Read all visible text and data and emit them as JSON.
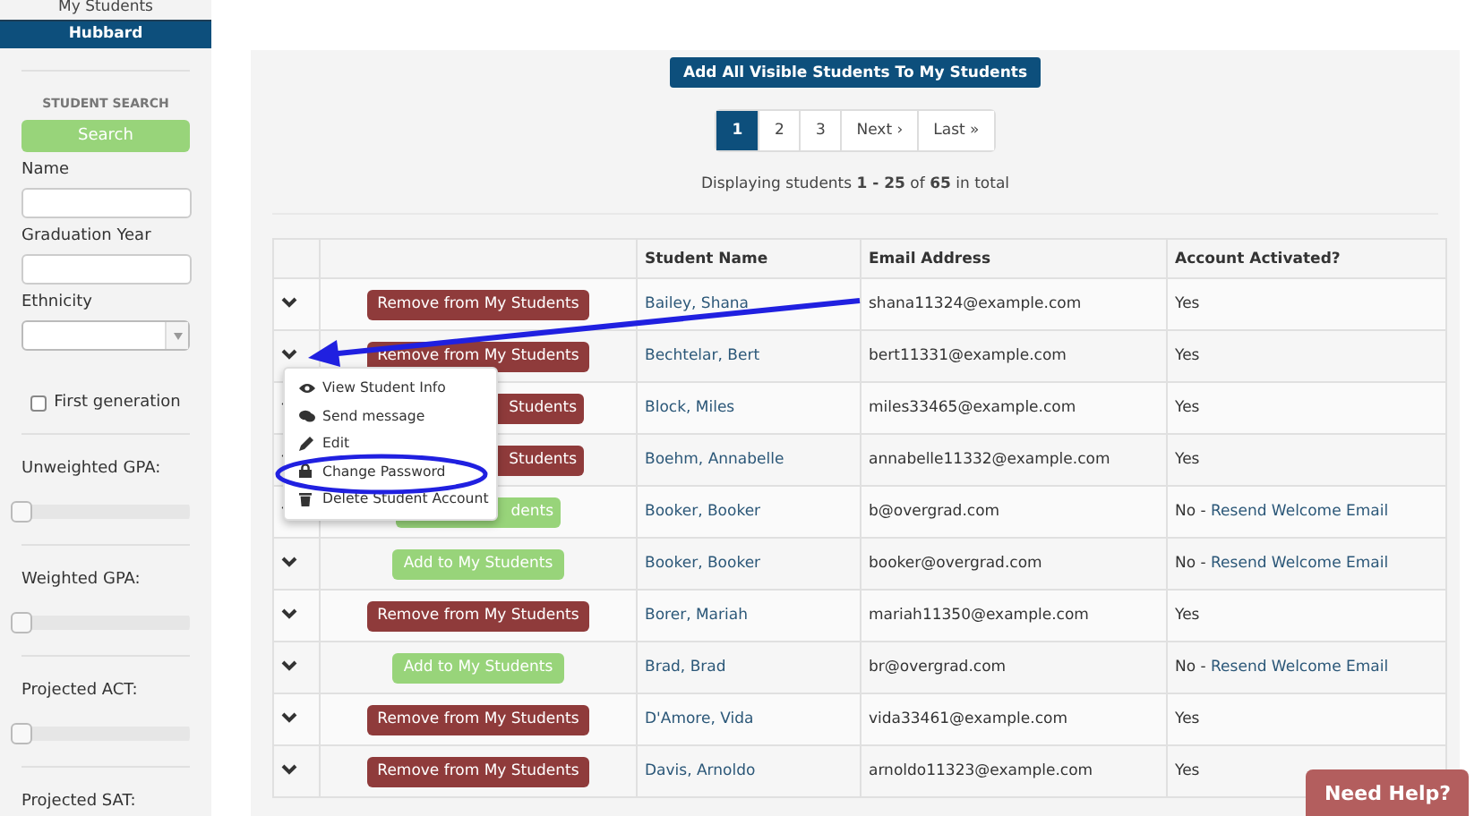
{
  "sidebar": {
    "nav": [
      {
        "label": "My Students",
        "selected": false
      },
      {
        "label": "Hubbard",
        "selected": true
      }
    ],
    "search_heading": "STUDENT SEARCH",
    "search_button": "Search",
    "filters": [
      {
        "kind": "text",
        "label": "Name"
      },
      {
        "kind": "text",
        "label": "Graduation Year"
      },
      {
        "kind": "select",
        "label": "Ethnicity"
      },
      {
        "kind": "checkbox",
        "label": "First generation",
        "checked": false
      },
      {
        "kind": "slider",
        "label": "Unweighted GPA:",
        "level": 0
      },
      {
        "kind": "slider",
        "label": "Weighted GPA:",
        "level": 0
      },
      {
        "kind": "slider",
        "label": "Projected ACT:",
        "level": 0
      },
      {
        "kind": "heading",
        "label": "Projected SAT:"
      }
    ]
  },
  "main": {
    "add_all_button": "Add All Visible Students To My Students",
    "pagination": [
      {
        "label": "1",
        "selected": true
      },
      {
        "label": "2",
        "selected": false
      },
      {
        "label": "3",
        "selected": false
      },
      {
        "label": "Next ›",
        "selected": false
      },
      {
        "label": "Last »",
        "selected": false
      }
    ],
    "summary": "Displaying students **1 - 25** of **65** in total",
    "table": {
      "columns": [
        "Student Name",
        "Email Address",
        "Account Activated?"
      ],
      "rows": [
        {
          "expanded": false,
          "action": {
            "kind": "remove",
            "label": "Remove from My Students"
          },
          "name": "Bailey, Shana",
          "email": "shana11324@example.com",
          "activated": "Yes"
        },
        {
          "expanded": true,
          "action": {
            "kind": "remove",
            "label": "Remove from My Students"
          },
          "name": "Bechtelar, Bert",
          "email": "bert11331@example.com",
          "activated": "Yes"
        },
        {
          "expanded": false,
          "action": {
            "kind": "remove",
            "label": "Students"
          },
          "name": "Block, Miles",
          "email": "miles33465@example.com",
          "activated": "Yes"
        },
        {
          "expanded": false,
          "action": {
            "kind": "remove",
            "label": "Students"
          },
          "name": "Boehm, Annabelle",
          "email": "annabelle11332@example.com",
          "activated": "Yes"
        },
        {
          "expanded": false,
          "action": {
            "kind": "add",
            "label": "dents"
          },
          "name": "Booker, Booker",
          "email": "b@overgrad.com",
          "activated": "No -",
          "resend_link": "Resend Welcome Email"
        },
        {
          "expanded": false,
          "action": {
            "kind": "add",
            "label": "Add to My Students"
          },
          "name": "Booker, Booker",
          "email": "booker@overgrad.com",
          "activated": "No -",
          "resend_link": "Resend Welcome Email"
        },
        {
          "expanded": false,
          "action": {
            "kind": "remove",
            "label": "Remove from My Students"
          },
          "name": "Borer, Mariah",
          "email": "mariah11350@example.com",
          "activated": "Yes"
        },
        {
          "expanded": false,
          "action": {
            "kind": "add",
            "label": "Add to My Students"
          },
          "name": "Brad, Brad",
          "email": "br@overgrad.com",
          "activated": "No -",
          "resend_link": "Resend Welcome Email"
        },
        {
          "expanded": false,
          "action": {
            "kind": "remove",
            "label": "Remove from My Students"
          },
          "name": "D'Amore, Vida",
          "email": "vida33461@example.com",
          "activated": "Yes"
        },
        {
          "expanded": false,
          "action": {
            "kind": "remove",
            "label": "Remove from My Students"
          },
          "name": "Davis, Arnoldo",
          "email": "arnoldo11323@example.com",
          "activated": "Yes"
        }
      ]
    },
    "row_menu": [
      {
        "label": "View Student Info"
      },
      {
        "label": "Send message"
      },
      {
        "label": "Edit"
      },
      {
        "label": "Change Password"
      },
      {
        "label": "Delete Student Account"
      }
    ]
  },
  "help_button": "Need Help?"
}
